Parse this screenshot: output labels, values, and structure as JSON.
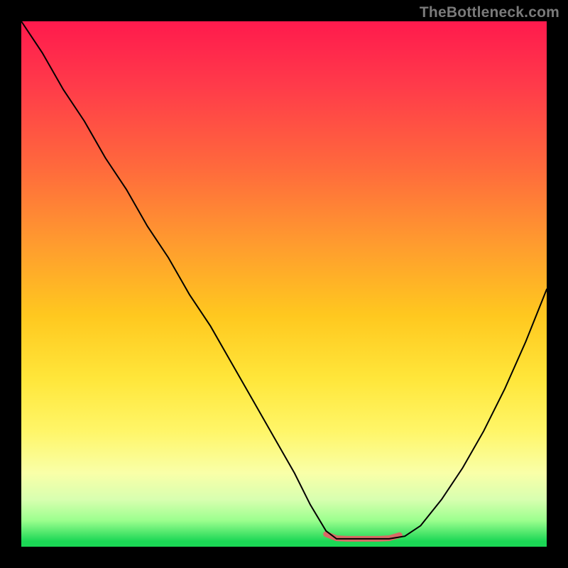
{
  "watermark": "TheBottleneck.com",
  "chart_data": {
    "type": "line",
    "title": "",
    "xlabel": "",
    "ylabel": "",
    "xlim": [
      0,
      100
    ],
    "ylim": [
      0,
      100
    ],
    "background": {
      "style": "vertical-gradient",
      "stops": [
        {
          "pct": 0,
          "color": "#ff1a4d"
        },
        {
          "pct": 12,
          "color": "#ff3a4a"
        },
        {
          "pct": 28,
          "color": "#ff6a3c"
        },
        {
          "pct": 42,
          "color": "#ff9a2f"
        },
        {
          "pct": 56,
          "color": "#ffc81f"
        },
        {
          "pct": 68,
          "color": "#ffe63a"
        },
        {
          "pct": 78,
          "color": "#fff668"
        },
        {
          "pct": 86,
          "color": "#f9ffa8"
        },
        {
          "pct": 91,
          "color": "#d8ffb0"
        },
        {
          "pct": 95,
          "color": "#9cff8e"
        },
        {
          "pct": 99,
          "color": "#1bd755"
        },
        {
          "pct": 100,
          "color": "#1bd755"
        }
      ]
    },
    "series": [
      {
        "name": "curve",
        "color": "#000000",
        "stroke_width": 2,
        "x": [
          0,
          4,
          8,
          12,
          16,
          20,
          24,
          28,
          32,
          36,
          40,
          44,
          48,
          52,
          55,
          58,
          60,
          62,
          65,
          70,
          73,
          76,
          80,
          84,
          88,
          92,
          96,
          100
        ],
        "y": [
          100,
          94,
          87,
          81,
          74,
          68,
          61,
          55,
          48,
          42,
          35,
          28,
          21,
          14,
          8,
          3,
          1.5,
          1.5,
          1.5,
          1.5,
          2,
          4,
          9,
          15,
          22,
          30,
          39,
          49
        ]
      },
      {
        "name": "trough-accent",
        "color": "#d96a66",
        "stroke_width": 8,
        "x": [
          58,
          60,
          62,
          64,
          66,
          68,
          70,
          72
        ],
        "y": [
          2.4,
          1.6,
          1.5,
          1.5,
          1.5,
          1.5,
          1.6,
          2.2
        ]
      }
    ],
    "minimum_point": {
      "x": 65,
      "y": 1.5
    }
  }
}
